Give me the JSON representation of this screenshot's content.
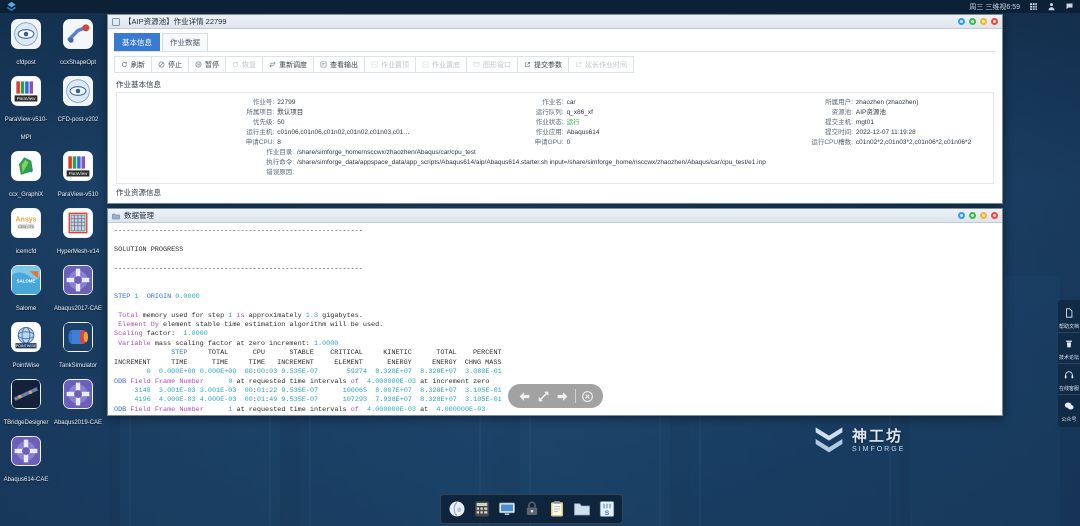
{
  "topbar": {
    "clock": "周三 三维视6:59",
    "icons": [
      "grid-icon",
      "user-icon",
      "chat-icon"
    ],
    "logo": "simforge-logo-icon"
  },
  "desktop": {
    "icons": [
      {
        "label": "cfdpost",
        "icon": "cfdpost-icon"
      },
      {
        "label": "ccxShapeOpt",
        "icon": "ccxshapeopt-icon"
      },
      {
        "label": "ParaView-v510-MPI",
        "icon": "paraview-icon"
      },
      {
        "label": "CFD-post-v202",
        "icon": "cfdpost-icon"
      },
      {
        "label": "ccx_GraphiX",
        "icon": "ccx-graphix-icon"
      },
      {
        "label": "ParaView-v510",
        "icon": "paraview-icon"
      },
      {
        "label": "icemcfd",
        "icon": "ansys-icemcfd-icon"
      },
      {
        "label": "HyperMesh-v14",
        "icon": "hypermesh-icon"
      },
      {
        "label": "Salome",
        "icon": "salome-icon"
      },
      {
        "label": "Abaqus2017-CAE",
        "icon": "abaqus-icon"
      },
      {
        "label": "PointWise",
        "icon": "pointwise-icon"
      },
      {
        "label": "TankSimulator",
        "icon": "tanksimulator-icon"
      },
      {
        "label": "TBridgeDesigner",
        "icon": "tbridgedesigner-icon"
      },
      {
        "label": "Abaqus2019-CAE",
        "icon": "abaqus-icon"
      },
      {
        "label": "Abaqus614-CAE",
        "icon": "abaqus-icon"
      }
    ]
  },
  "job_window": {
    "title": "【AIP资源池】作业详情 22799",
    "title_icon": "window-icon",
    "window_buttons": [
      "help-blue",
      "minimize-green",
      "maximize-yellow",
      "close-red"
    ],
    "tabs": [
      {
        "label": "基本信息",
        "active": true
      },
      {
        "label": "作业数据",
        "active": false
      }
    ],
    "toolbar": [
      {
        "label": "刷新",
        "icon": "refresh-icon",
        "disabled": false
      },
      {
        "label": "停止",
        "icon": "stop-icon",
        "disabled": false
      },
      {
        "label": "暂停",
        "icon": "pause-icon",
        "disabled": false
      },
      {
        "label": "恢复",
        "icon": "resume-icon",
        "disabled": true
      },
      {
        "label": "重新调度",
        "icon": "reschedule-icon",
        "disabled": false
      },
      {
        "label": "查看输出",
        "icon": "output-icon",
        "disabled": false
      },
      {
        "label": "作业置顶",
        "icon": "pin-top-icon",
        "disabled": true
      },
      {
        "label": "作业置底",
        "icon": "pin-bottom-icon",
        "disabled": true
      },
      {
        "label": "图形窗口",
        "icon": "graphics-window-icon",
        "disabled": true
      },
      {
        "label": "提交参数",
        "icon": "submit-params-icon",
        "disabled": false
      },
      {
        "label": "延长作业时间",
        "icon": "extend-time-icon",
        "disabled": true
      }
    ],
    "section_basic": "作业基本信息",
    "section_resource": "作业资源信息",
    "fields_col1": [
      {
        "label": "作业号:",
        "value": "22799"
      },
      {
        "label": "所属项目:",
        "value": "默认项目"
      },
      {
        "label": "优先级:",
        "value": "50"
      },
      {
        "label": "运行主机:",
        "value": "c01n06,c01n06,c01n02,c01n02,c01n03,c01n03,..."
      },
      {
        "label": "申请CPU:",
        "value": "8"
      }
    ],
    "fields_col2": [
      {
        "label": "作业名:",
        "value": "car"
      },
      {
        "label": "运行队列:",
        "value": "q_x86_xf"
      },
      {
        "label": "作业状态:",
        "value": "运行",
        "state": "running"
      },
      {
        "label": "作业应用:",
        "value": "Abaqus614"
      },
      {
        "label": "申请GPU:",
        "value": "0"
      }
    ],
    "fields_col3": [
      {
        "label": "所属用户:",
        "value": "zhaozhen (zhaozhen)"
      },
      {
        "label": "资源池:",
        "value": "AIP资源池"
      },
      {
        "label": "提交主机:",
        "value": "mgt01"
      },
      {
        "label": "提交时间:",
        "value": "2022-12-07 11:19:28"
      },
      {
        "label": "运行CPU槽数:",
        "value": "c01n02*2,c01n03*2,c01n06*2,c01n06*2"
      }
    ],
    "fields_wide": [
      {
        "label": "作业目录:",
        "value": "/share/simforge_home/nsccwx/zhaozhen/Abaqus/car/cpu_test"
      },
      {
        "label": "执行命令:",
        "value": "/share/simforge_data/appspace_data/app_scripts/Abaqus614/aip/Abaqus614.starter.sh input=/share/simforge_home/nsccwx/zhaozhen/Abaqus/car/cpu_test/e1.inp"
      },
      {
        "label": "错误原因:",
        "value": ""
      }
    ]
  },
  "terminal_window": {
    "title": "数据管理",
    "title_icon": "folder-icon",
    "window_buttons": [
      "help-blue",
      "minimize-green",
      "maximize-yellow",
      "close-red"
    ],
    "content_lines": [
      "-------------------------------------------------------------",
      "",
      "SOLUTION PROGRESS",
      "",
      "-------------------------------------------------------------",
      "",
      "",
      "STEP 1  ORIGIN 0.0000",
      "",
      " Total memory used for step 1 is approximately 1.3 gigabytes.",
      " Element by element stable time estimation algorithm will be used.",
      "Scaling factor:  1.0000",
      " Variable mass scaling factor at zero increment: 1.0000",
      "              STEP     TOTAL      CPU      STABLE    CRITICAL     KINETIC      TOTAL    PERCENT",
      "INCREMENT     TIME      TIME     TIME   INCREMENT     ELEMENT      ENERGY     ENERGY  CHNG MASS",
      "        0  0.000E+00 0.000E+00  00:00:03 9.535E-07       59274  8.328E+07  8.328E+07  3.080E-01",
      "ODB Field Frame Number      0 at requested time intervals of  4.000000E-03 at increment zero",
      "     3148  3.001E-03 3.001E-03  00:01:22 9.535E-07      100065  8.007E+07  8.328E+07  3.105E-01",
      "     4196  4.000E-03 4.000E-03  00:01:49 9.535E-07      107293  7.938E+07  8.328E+07  3.105E-01",
      "ODB Field Frame Number      1 at requested time intervals of  4.000000E-03 at  4.000000E-03"
    ]
  },
  "float_nav": {
    "buttons": [
      "back-arrow-icon",
      "resize-icon",
      "forward-arrow-icon",
      "close-icon"
    ]
  },
  "right_dock": [
    {
      "label": "帮助文档",
      "icon": "document-icon"
    },
    {
      "label": "技术论坛",
      "icon": "forum-icon"
    },
    {
      "label": "在线客服",
      "icon": "headset-icon"
    },
    {
      "label": "公众号",
      "icon": "wechat-icon"
    }
  ],
  "brand": {
    "name": "神工坊",
    "subtitle": "SIMFORGE",
    "icon": "simforge-mark-icon"
  },
  "taskbar": [
    {
      "icon": "browser-icon"
    },
    {
      "icon": "calculator-icon"
    },
    {
      "icon": "monitor-icon"
    },
    {
      "icon": "lock-icon"
    },
    {
      "icon": "clipboard-icon"
    },
    {
      "icon": "folder-icon"
    },
    {
      "icon": "simforge-app-icon"
    }
  ],
  "colors": {
    "accent": "#3a7bd0",
    "running": "#2faa4a",
    "desktop": "#1d4166"
  }
}
